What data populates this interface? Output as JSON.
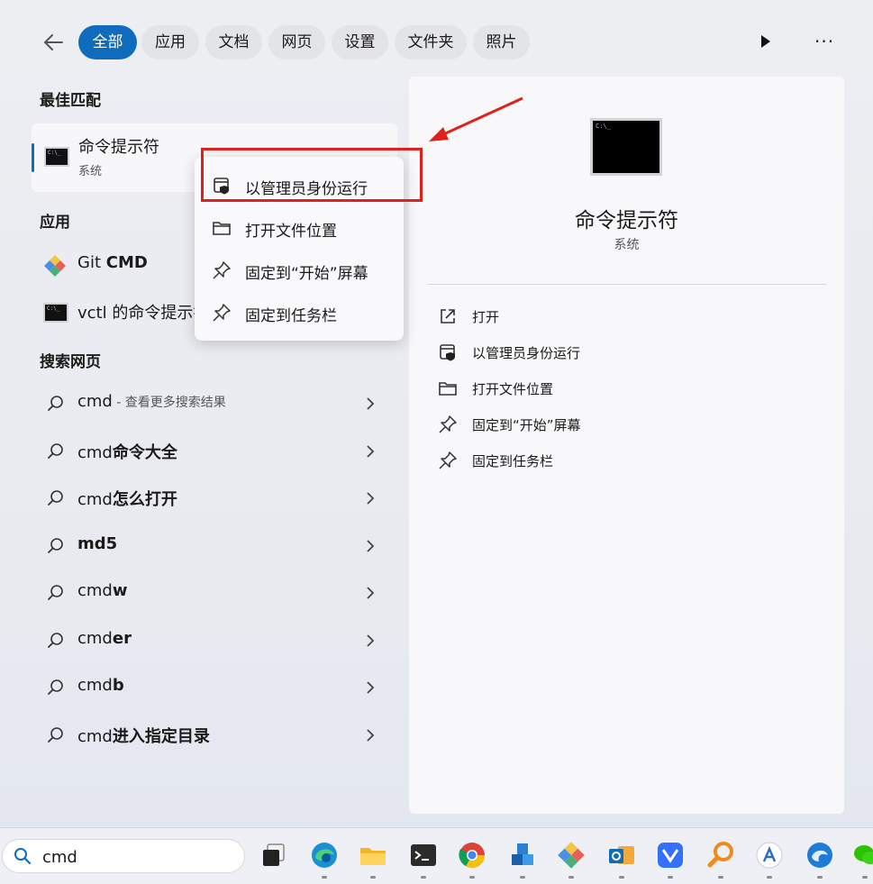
{
  "filters": {
    "back_label": "",
    "tabs": [
      {
        "label": "全部",
        "active": true
      },
      {
        "label": "应用"
      },
      {
        "label": "文档"
      },
      {
        "label": "网页"
      },
      {
        "label": "设置"
      },
      {
        "label": "文件夹"
      },
      {
        "label": "照片"
      }
    ],
    "more_label": "···"
  },
  "best_match": {
    "heading": "最佳匹配",
    "title": "命令提示符",
    "subtitle": "系统"
  },
  "apps": {
    "heading": "应用",
    "items": [
      {
        "prefix": "Git ",
        "bold": "CMD",
        "icon": "git-icon"
      },
      {
        "prefix": "vctl 的命令提示符",
        "bold": "",
        "icon": "cmd-icon"
      }
    ]
  },
  "web": {
    "heading": "搜索网页",
    "items": [
      {
        "prefix": "cmd",
        "bold": "",
        "hint": " - 查看更多搜索结果"
      },
      {
        "prefix": "cmd",
        "bold": "命令大全",
        "hint": ""
      },
      {
        "prefix": "cmd",
        "bold": "怎么打开",
        "hint": ""
      },
      {
        "prefix": "",
        "bold": "md5",
        "hint": ""
      },
      {
        "prefix": "cmd",
        "bold": "w",
        "hint": ""
      },
      {
        "prefix": "cmd",
        "bold": "er",
        "hint": ""
      },
      {
        "prefix": "cmd",
        "bold": "b",
        "hint": ""
      },
      {
        "prefix": "cmd",
        "bold": "进入指定目录",
        "hint": ""
      }
    ]
  },
  "context_menu": {
    "items": [
      {
        "label": "以管理员身份运行",
        "icon": "admin-shield-icon"
      },
      {
        "label": "打开文件位置",
        "icon": "folder-icon"
      },
      {
        "label": "固定到“开始”屏幕",
        "icon": "pin-icon"
      },
      {
        "label": "固定到任务栏",
        "icon": "pin-icon"
      }
    ]
  },
  "detail": {
    "title": "命令提示符",
    "subtitle": "系统",
    "actions": [
      {
        "label": "打开",
        "icon": "open-external-icon"
      },
      {
        "label": "以管理员身份运行",
        "icon": "admin-shield-icon"
      },
      {
        "label": "打开文件位置",
        "icon": "folder-icon"
      },
      {
        "label": "固定到“开始”屏幕",
        "icon": "pin-icon"
      },
      {
        "label": "固定到任务栏",
        "icon": "pin-icon"
      }
    ]
  },
  "taskbar": {
    "search_value": "cmd",
    "apps": [
      "task-view-icon",
      "edge-icon",
      "file-explorer-icon",
      "terminal-icon",
      "chrome-icon",
      "cube-app-icon",
      "git-icon",
      "outlook-icon",
      "feishu-icon",
      "search-tool-icon",
      "app-store-icon",
      "browser-icon",
      "wechat-icon"
    ]
  },
  "colors": {
    "accent": "#0f6cbd",
    "highlight_red": "#e0201a"
  }
}
